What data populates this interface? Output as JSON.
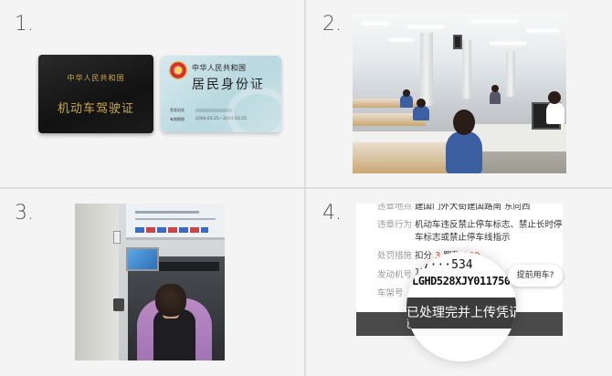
{
  "steps": [
    {
      "number": "1."
    },
    {
      "number": "2."
    },
    {
      "number": "3."
    },
    {
      "number": "4."
    }
  ],
  "documents": {
    "license": {
      "country": "中华人民共和国",
      "title": "机动车驾驶证"
    },
    "id_card": {
      "country": "中华人民共和国",
      "title": "居民身份证",
      "row1_label": "签发机关",
      "row2_label": "有效期限",
      "validity": "2004.03.25—2024.03.25"
    }
  },
  "violation": {
    "location_label": "违章地点",
    "location_value": "建国门外大街建国路南 东向西",
    "behavior_label": "违章行为",
    "behavior_line1": "机动车违反禁止停车标志、禁止长时停",
    "behavior_line2": "车标志或禁止停车线指示",
    "penalty_label": "处罚措施",
    "points_label": "扣分",
    "points_value": "3",
    "fine_label": "罚款",
    "fine_value": "200",
    "engine_label": "发动机号",
    "engine_value": "17···534",
    "frame_label": "车架号",
    "frame_value": "LGHD528XJY011750",
    "early_button": "提前用车?",
    "upload_button": "已处理完并上传凭证"
  }
}
